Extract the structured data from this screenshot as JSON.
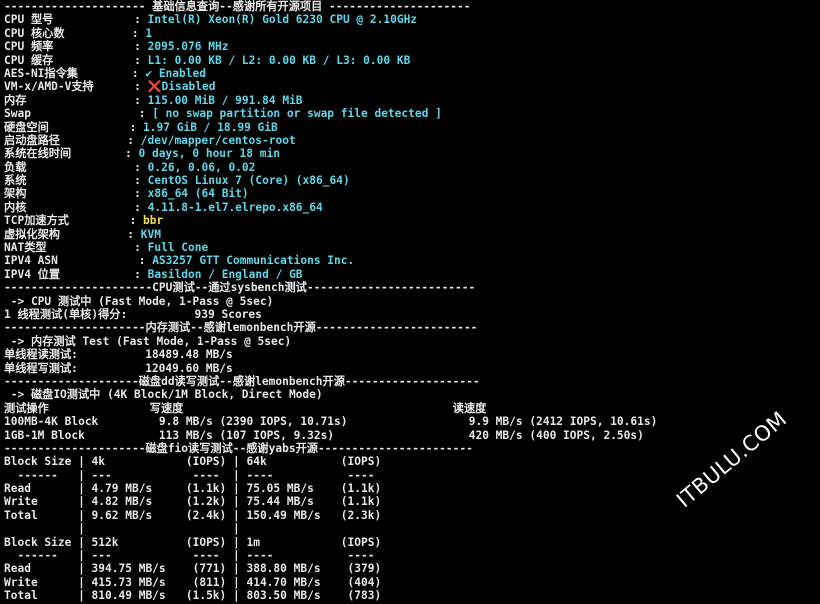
{
  "lines": [
    {
      "t": "--------------------- 基础信息查询--感谢所有开源项目 ---------------------"
    },
    {
      "k": "CPU 型号            : ",
      "v": "Intel(R) Xeon(R) Gold 6230 CPU @ 2.10GHz",
      "c": "v"
    },
    {
      "k": "CPU 核心数          : ",
      "v": "1",
      "c": "v"
    },
    {
      "k": "CPU 频率            : ",
      "v": "2095.076 MHz",
      "c": "v"
    },
    {
      "k": "CPU 缓存            : ",
      "v": "L1: 0.00 KB / L2: 0.00 KB / L3: 0.00 KB",
      "c": "v"
    },
    {
      "k": "AES-NI指令集        : ",
      "v": "✔ Enabled",
      "c": "v"
    },
    {
      "k": "VM-x/AMD-V支持      : ",
      "v": "❌Disabled",
      "c": "v"
    },
    {
      "k": "内存                : ",
      "v": "115.00 MiB / 991.84 MiB",
      "c": "v"
    },
    {
      "k": "Swap                : ",
      "v": "[ no swap partition or swap file detected ]",
      "c": "v"
    },
    {
      "k": "硬盘空间            : ",
      "v": "1.97 GiB / 18.99 GiB",
      "c": "v"
    },
    {
      "k": "启动盘路径          : ",
      "v": "/dev/mapper/centos-root",
      "c": "v"
    },
    {
      "k": "系统在线时间        : ",
      "v": "0 days, 0 hour 18 min",
      "c": "v"
    },
    {
      "k": "负载                : ",
      "v": "0.26, 0.06, 0.02",
      "c": "v"
    },
    {
      "k": "系统                : ",
      "v": "CentOS Linux 7 (Core) (x86_64)",
      "c": "v"
    },
    {
      "k": "架构                : ",
      "v": "x86_64 (64 Bit)",
      "c": "v"
    },
    {
      "k": "内核                : ",
      "v": "4.11.8-1.el7.elrepo.x86_64",
      "c": "v"
    },
    {
      "k": "TCP加速方式         : ",
      "v": "bbr",
      "c": "y"
    },
    {
      "k": "虚拟化架构          : ",
      "v": "KVM",
      "c": "v"
    },
    {
      "k": "NAT类型             : ",
      "v": "Full Cone",
      "c": "v"
    },
    {
      "k": "IPV4 ASN            : ",
      "v": "AS3257 GTT Communications Inc.",
      "c": "v"
    },
    {
      "k": "IPV4 位置           : ",
      "v": "Basildon / England / GB",
      "c": "v"
    },
    {
      "t": "----------------------CPU测试--通过sysbench测试-------------------------"
    },
    {
      "t": " -> CPU 测试中 (Fast Mode, 1-Pass @ 5sec)"
    },
    {
      "t": "1 线程测试(单核)得分:          939 Scores"
    },
    {
      "t": "---------------------内存测试--感谢lemonbench开源------------------------"
    },
    {
      "t": " -> 内存测试 Test (Fast Mode, 1-Pass @ 5sec)"
    },
    {
      "t": "单线程读测试:          18489.48 MB/s"
    },
    {
      "t": "单线程写测试:          12049.60 MB/s"
    },
    {
      "t": "--------------------磁盘dd读写测试--感谢lemonbench开源--------------------"
    },
    {
      "t": " -> 磁盘IO测试中 (4K Block/1M Block, Direct Mode)"
    },
    {
      "t": "测试操作               写速度                                        读速度"
    },
    {
      "t": "100MB-4K Block         9.8 MB/s (2390 IOPS, 10.71s)                  9.9 MB/s (2412 IOPS, 10.61s)"
    },
    {
      "t": "1GB-1M Block           113 MB/s (107 IOPS, 9.32s)                    420 MB/s (400 IOPS, 2.50s)"
    },
    {
      "t": "---------------------磁盘fio读写测试--感谢yabs开源-----------------------"
    },
    {
      "t": "Block Size | 4k            (IOPS) | 64k           (IOPS)"
    },
    {
      "t": "  ------   | ---            ----  | ----           ---- "
    },
    {
      "t": "Read       | 4.79 MB/s     (1.1k) | 75.05 MB/s    (1.1k)"
    },
    {
      "t": "Write      | 4.82 MB/s     (1.2k) | 75.44 MB/s    (1.1k)"
    },
    {
      "t": "Total      | 9.62 MB/s     (2.4k) | 150.49 MB/s   (2.3k)"
    },
    {
      "t": "           |                      |"
    },
    {
      "t": "Block Size | 512k          (IOPS) | 1m            (IOPS)"
    },
    {
      "t": "  ------   | ---            ----  | ----           ---- "
    },
    {
      "t": "Read       | 394.75 MB/s    (771) | 388.80 MB/s    (379)"
    },
    {
      "t": "Write      | 415.73 MB/s    (811) | 414.70 MB/s    (404)"
    },
    {
      "t": "Total      | 810.49 MB/s   (1.5k) | 803.50 MB/s    (783)"
    }
  ],
  "watermark": "ITBULU.COM",
  "colors": {
    "value": "#5fd7e8",
    "highlight": "#f0e442",
    "text": "#e8e8e8",
    "background": "#000000"
  }
}
